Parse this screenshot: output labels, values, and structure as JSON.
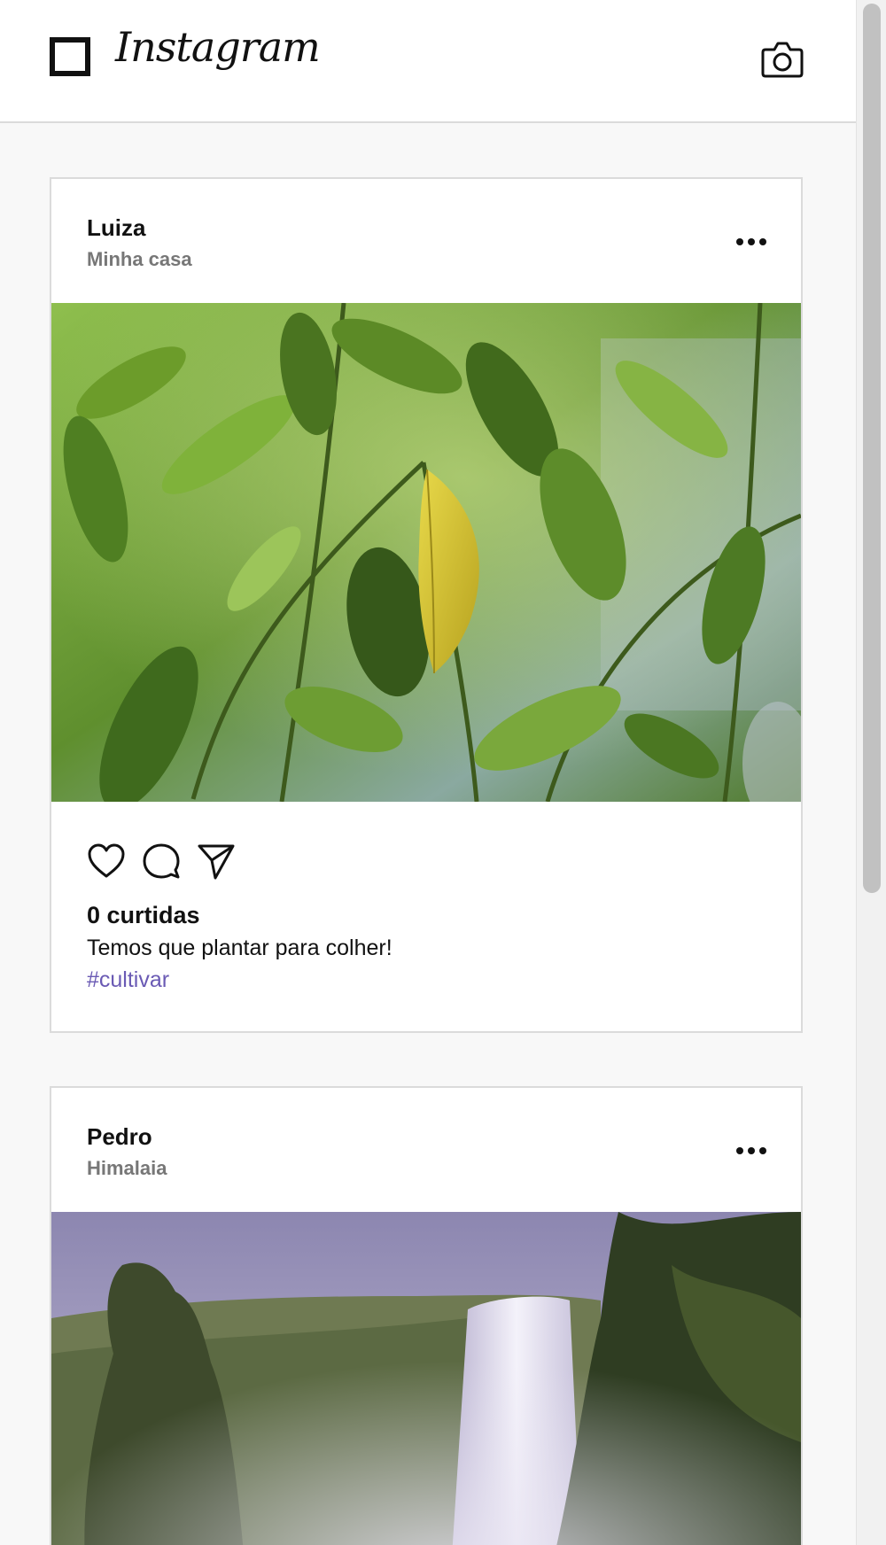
{
  "header": {
    "app_name": "Instagram",
    "logo_icon": "square-logo-icon",
    "camera_icon": "camera-icon"
  },
  "posts": [
    {
      "username": "Luiza",
      "location": "Minha casa",
      "more_icon": "more-horizontal-icon",
      "image": "green-leaves-photo",
      "action_icons": [
        "heart-icon",
        "comment-icon",
        "send-icon"
      ],
      "likes": "0 curtidas",
      "caption": "Temos que plantar para colher!",
      "hashtag": "#cultivar"
    },
    {
      "username": "Pedro",
      "location": "Himalaia",
      "more_icon": "more-horizontal-icon",
      "image": "waterfall-photo"
    }
  ],
  "colors": {
    "hashtag": "#6a5ab4",
    "location": "#777777",
    "border": "#dbdbdb",
    "background": "#f8f8f8"
  }
}
